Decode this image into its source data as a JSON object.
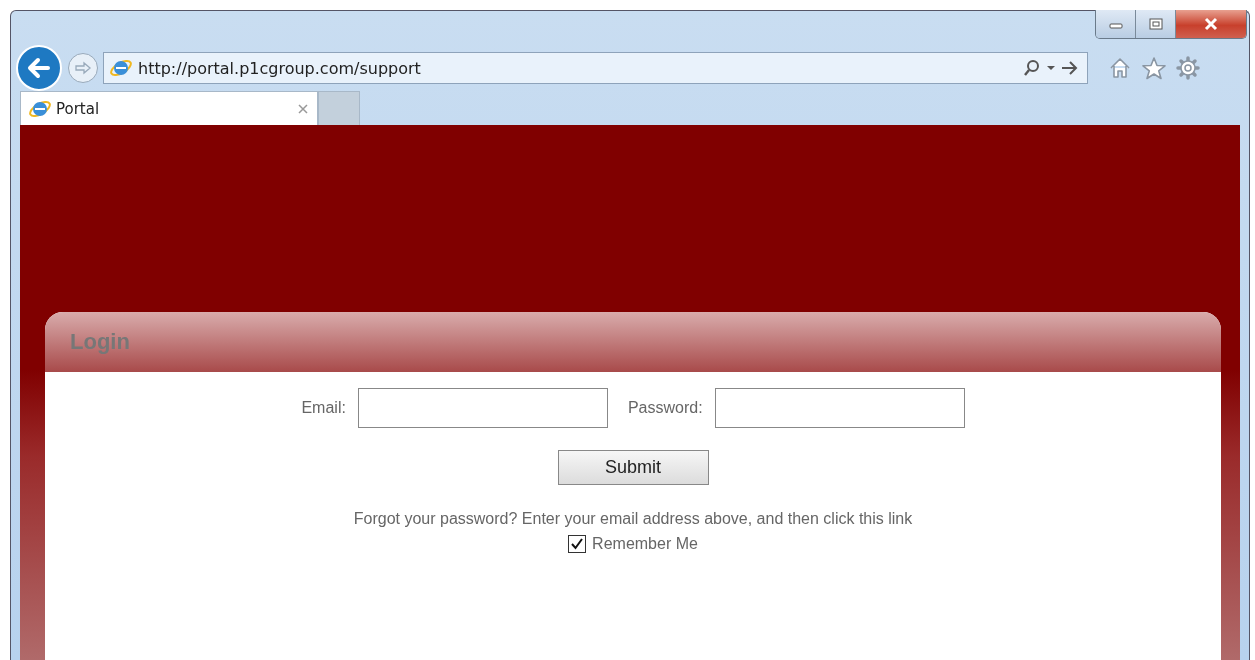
{
  "browser": {
    "address": "http://portal.p1cgroup.com/support",
    "tabs": [
      {
        "title": "Portal",
        "selected": true
      }
    ]
  },
  "login": {
    "title": "Login",
    "fields": [
      {
        "label": "Email:"
      },
      {
        "label": "Password:"
      }
    ],
    "submit": "Submit",
    "forgot_text": "Forgot your password? Enter your email address above, and then click this link",
    "remember": {
      "label": "Remember Me",
      "checked": true
    }
  }
}
